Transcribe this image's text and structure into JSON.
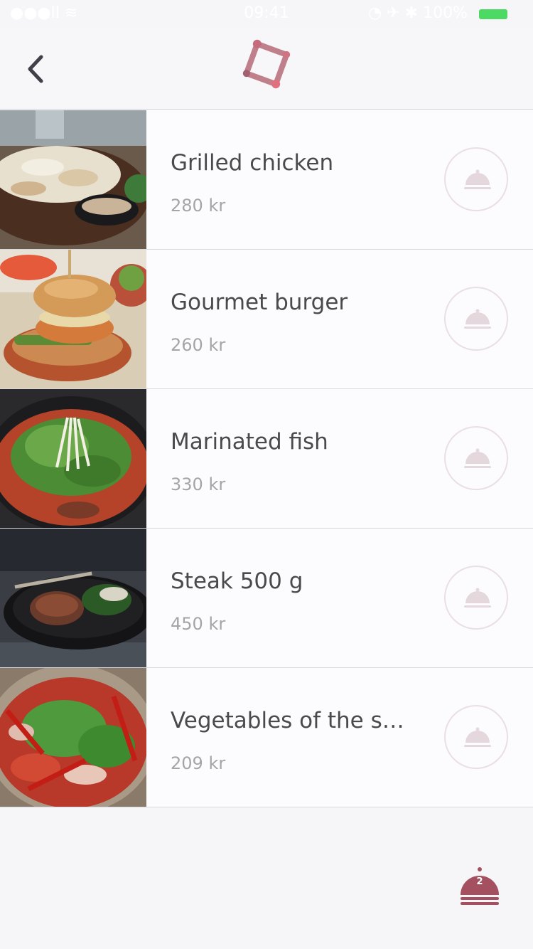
{
  "status_bar": {
    "signal": "●●●ll ≋",
    "time": "09:41",
    "right_indicators": "◔ ✈ ✱ 100%"
  },
  "colors": {
    "accent": "#a55060",
    "accent_light": "#eadfe3",
    "battery": "#4cd964",
    "title_text": "#4a4a4a",
    "price_text": "#a5a5a5"
  },
  "menu_items": [
    {
      "name": "Grilled chicken",
      "price": "280 kr",
      "image": "grilled-chicken-photo"
    },
    {
      "name": "Gourmet burger",
      "price": "260 kr",
      "image": "gourmet-burger-photo"
    },
    {
      "name": "Marinated fish",
      "price": "330 kr",
      "image": "marinated-fish-photo"
    },
    {
      "name": "Steak 500 g",
      "price": "450 kr",
      "image": "steak-photo"
    },
    {
      "name": "Vegetables of the s…",
      "price": "209 kr",
      "image": "vegetables-photo"
    }
  ],
  "cart": {
    "count": "2",
    "icon": "cloche-icon"
  }
}
